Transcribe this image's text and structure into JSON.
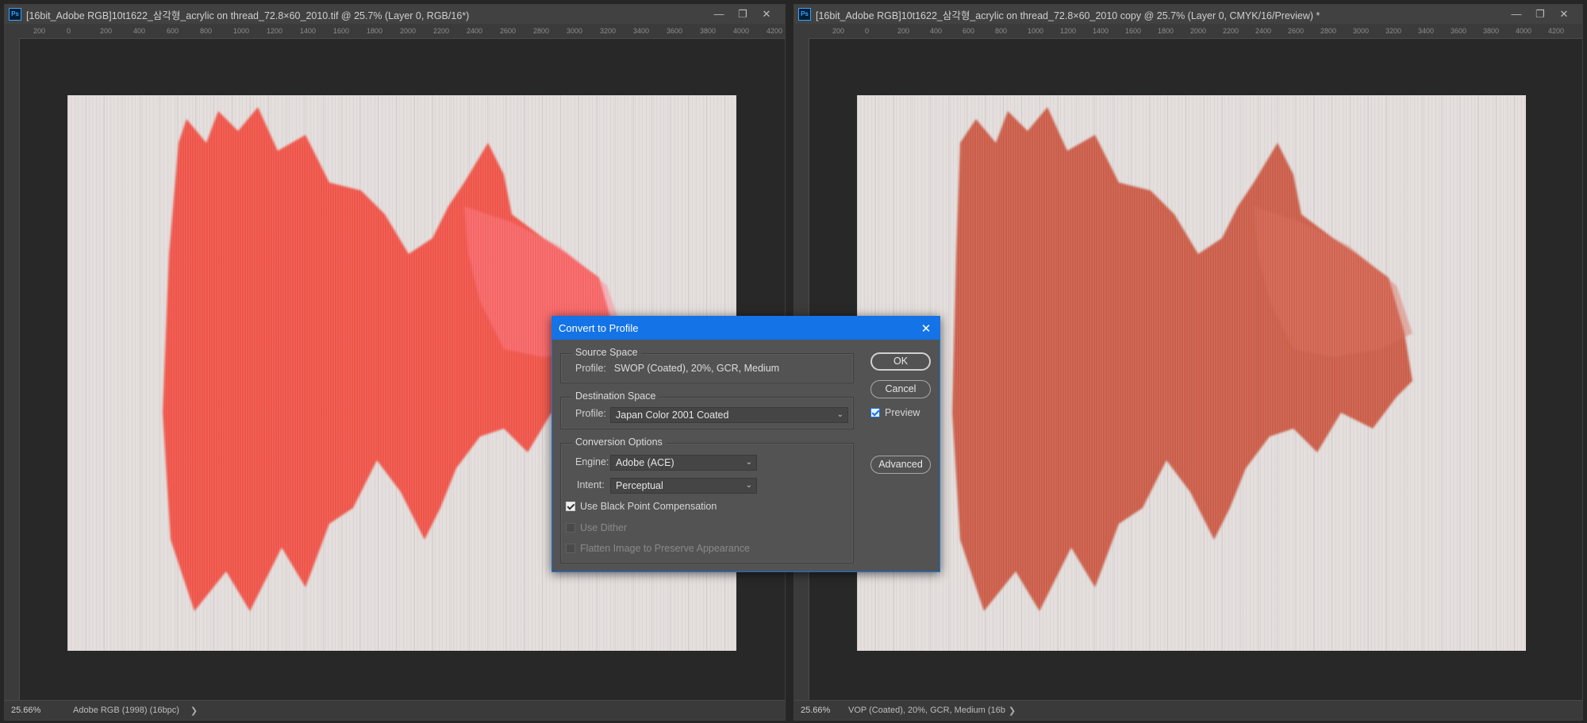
{
  "left_doc": {
    "title": "[16bit_Adobe RGB]10t1622_삼각형_acrylic on thread_72.8×60_2010.tif @ 25.7% (Layer 0, RGB/16*)",
    "zoom": "25.66%",
    "status_profile": "Adobe RGB (1998) (16bpc)",
    "status_arrow": "❯",
    "ruler_ticks": [
      "200",
      "0",
      "200",
      "400",
      "600",
      "800",
      "1000",
      "1200",
      "1400",
      "1600",
      "1800",
      "2000",
      "2200",
      "2400",
      "2600",
      "2800",
      "3000",
      "3200",
      "3400",
      "3600",
      "3800",
      "4000",
      "4200"
    ]
  },
  "right_doc": {
    "title": "[16bit_Adobe RGB]10t1622_삼각형_acrylic on thread_72.8×60_2010 copy @ 25.7% (Layer 0, CMYK/16/Preview) *",
    "zoom": "25.66%",
    "status_profile": "VOP (Coated), 20%, GCR, Medium (16b",
    "status_arrow": "❯",
    "ruler_ticks": [
      "200",
      "0",
      "200",
      "400",
      "600",
      "800",
      "1000",
      "1200",
      "1400",
      "1600",
      "1800",
      "2000",
      "2200",
      "2400",
      "2600",
      "2800",
      "3000",
      "3200",
      "3400",
      "3600",
      "3800",
      "4000",
      "4200"
    ]
  },
  "window_controls": {
    "minimize": "—",
    "restore": "❐",
    "close": "✕"
  },
  "ps_icon": "Ps",
  "icons": [
    "photoshop-icon",
    "minimize-icon",
    "restore-icon",
    "close-icon",
    "chevron-down-icon",
    "checkbox-icon",
    "chevron-right-icon"
  ],
  "colors": {
    "rgb_paint": "#f0463a",
    "cmyk_paint": "#c8503a",
    "dialog_accent": "#1473e6"
  },
  "dialog": {
    "title": "Convert to Profile",
    "close": "✕",
    "source_space": {
      "label": "Source Space",
      "profile_label": "Profile:",
      "profile_value": "SWOP (Coated), 20%, GCR, Medium"
    },
    "destination_space": {
      "label": "Destination Space",
      "profile_label": "Profile:",
      "profile_value": "Japan Color 2001 Coated"
    },
    "conversion_options": {
      "label": "Conversion Options",
      "engine_label": "Engine:",
      "engine_value": "Adobe (ACE)",
      "intent_label": "Intent:",
      "intent_value": "Perceptual",
      "black_point": "Use Black Point Compensation",
      "black_point_checked": true,
      "dither": "Use Dither",
      "flatten": "Flatten Image to Preserve Appearance"
    },
    "ok": "OK",
    "cancel": "Cancel",
    "preview": "Preview",
    "preview_checked": true,
    "advanced": "Advanced"
  }
}
